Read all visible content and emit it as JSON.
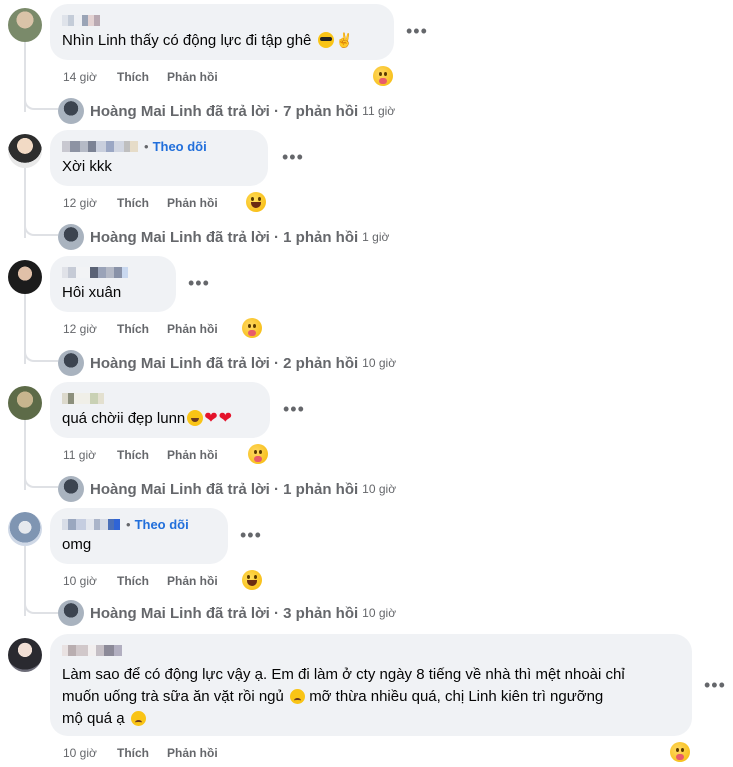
{
  "colors": {
    "bubble": "#f0f2f5",
    "link": "#216fdb",
    "muted": "#65676b",
    "text": "#050505",
    "line": "#dfe1e5"
  },
  "comments": [
    {
      "text": "Nhìn Linh thấy có động lực đi tập ghê",
      "emojis": [
        "smiling-face-with-sunglasses",
        "victory-hand"
      ],
      "time": "14 giờ",
      "like": "Thích",
      "reply": "Phản hồi",
      "reaction": "care",
      "replies": {
        "author": "Hoàng Mai Linh",
        "text": "Hoàng Mai Linh đã trả lời · 7 phản hồi",
        "time": "11 giờ"
      }
    },
    {
      "follow": "Theo dõi",
      "text": "Xời kkk",
      "time": "12 giờ",
      "like": "Thích",
      "reply": "Phản hồi",
      "reaction": "haha",
      "replies": {
        "text": "Hoàng Mai Linh đã trả lời · 1 phản hồi",
        "time": "1 giờ"
      }
    },
    {
      "text": "Hôi xuân",
      "time": "12 giờ",
      "like": "Thích",
      "reply": "Phản hồi",
      "reaction": "care",
      "replies": {
        "text": "Hoàng Mai Linh đã trả lời · 2 phản hồi",
        "time": "10 giờ"
      }
    },
    {
      "text": "quá chờii đẹp lunn",
      "emojis": [
        "grinning-squinting-face",
        "red-heart",
        "red-heart"
      ],
      "time": "11 giờ",
      "like": "Thích",
      "reply": "Phản hồi",
      "reaction": "care",
      "replies": {
        "text": "Hoàng Mai Linh đã trả lời · 1 phản hồi",
        "time": "10 giờ"
      }
    },
    {
      "follow": "Theo dõi",
      "text": "omg",
      "time": "10 giờ",
      "like": "Thích",
      "reply": "Phản hồi",
      "reaction": "haha",
      "replies": {
        "text": "Hoàng Mai Linh đã trả lời · 3 phản hồi",
        "time": "10 giờ"
      }
    },
    {
      "text_line1": "Làm sao để có động lực vậy ạ. Em đi làm ở cty ngày 8 tiếng về nhà thì mệt nhoài chỉ",
      "text_line2a": "muốn uống trà sữa ăn vặt rồi ngủ",
      "text_line2b": "mỡ thừa nhiều quá, chị Linh kiên trì ngưỡng",
      "text_line3": "mộ quá ạ",
      "emojis": [
        "frowning-face",
        "frowning-face"
      ],
      "time": "10 giờ",
      "like": "Thích",
      "reply": "Phản hồi",
      "reaction": "care"
    }
  ]
}
